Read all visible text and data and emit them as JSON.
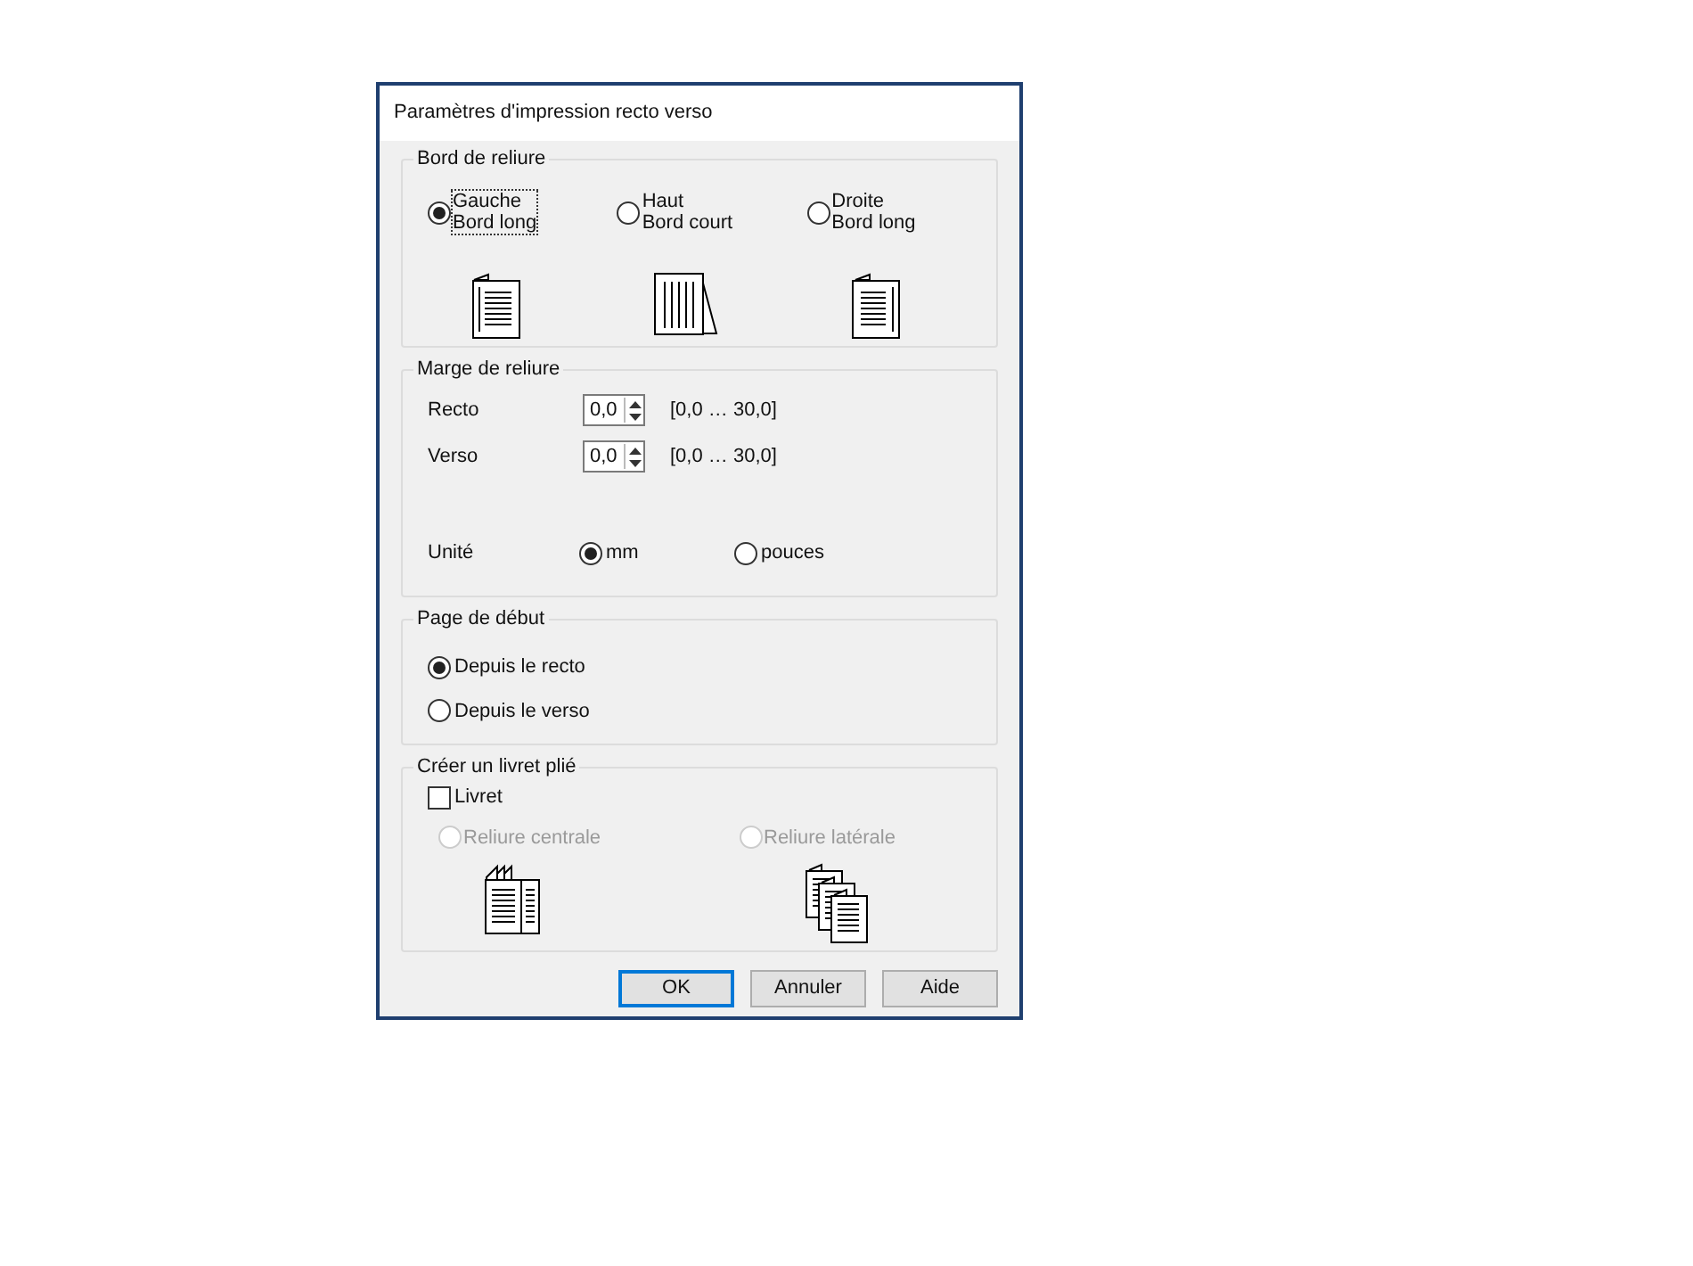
{
  "window": {
    "title": "Paramètres d'impression recto verso"
  },
  "binding_edge": {
    "label": "Bord de reliure",
    "options": [
      {
        "label": "Gauche",
        "sublabel": "Bord long",
        "selected": true,
        "focused": true,
        "kind": "left"
      },
      {
        "label": "Haut",
        "sublabel": "Bord court",
        "selected": false,
        "focused": false,
        "kind": "top"
      },
      {
        "label": "Droite",
        "sublabel": "Bord long",
        "selected": false,
        "focused": false,
        "kind": "right"
      }
    ]
  },
  "binding_margin": {
    "label": "Marge de reliure",
    "fields": [
      {
        "label": "Recto",
        "value": "0,0",
        "range": "[0,0 … 30,0]"
      },
      {
        "label": "Verso",
        "value": "0,0",
        "range": "[0,0 … 30,0]"
      }
    ],
    "unit": {
      "label": "Unité",
      "options": [
        {
          "label": "mm",
          "selected": true
        },
        {
          "label": "pouces",
          "selected": false
        }
      ]
    }
  },
  "start_page": {
    "label": "Page de début",
    "options": [
      {
        "label": "Depuis le recto",
        "selected": true
      },
      {
        "label": "Depuis le verso",
        "selected": false
      }
    ]
  },
  "booklet": {
    "label": "Créer un livret plié",
    "checkbox": {
      "label": "Livret",
      "checked": false
    },
    "options": [
      {
        "label": "Reliure centrale",
        "selected": false,
        "disabled": true,
        "kind": "center"
      },
      {
        "label": "Reliure latérale",
        "selected": false,
        "disabled": true,
        "kind": "side"
      }
    ]
  },
  "buttons": [
    {
      "label": "OK",
      "default": true
    },
    {
      "label": "Annuler",
      "default": false
    },
    {
      "label": "Aide",
      "default": false
    }
  ]
}
